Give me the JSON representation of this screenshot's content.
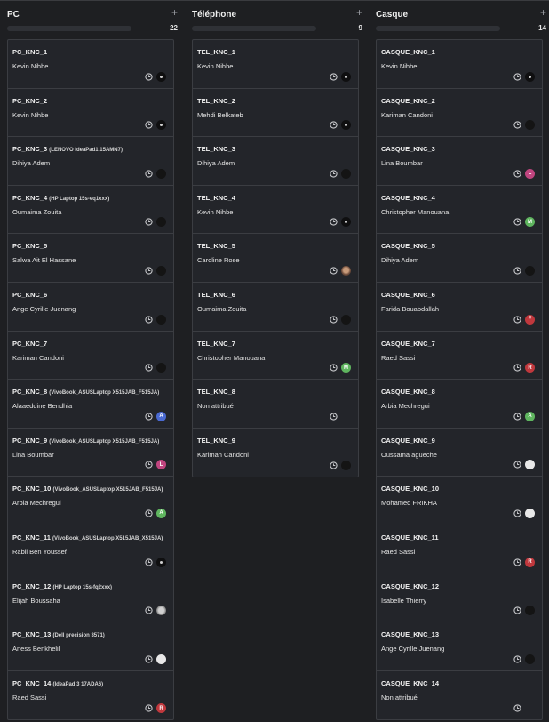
{
  "columns": [
    {
      "title": "PC",
      "count": "22",
      "cards": [
        {
          "title": "PC_KNC_1",
          "sub": "",
          "owner": "Kevin Nihbe",
          "avatar": {
            "kind": "dark",
            "letter": ""
          }
        },
        {
          "title": "PC_KNC_2",
          "sub": "",
          "owner": "Kevin Nihbe",
          "avatar": {
            "kind": "dark",
            "letter": ""
          }
        },
        {
          "title": "PC_KNC_3",
          "sub": "(LENOVO IdeaPad1 15AMN7)",
          "owner": "Dihiya Adem",
          "avatar": {
            "kind": "photo",
            "letter": ""
          }
        },
        {
          "title": "PC_KNC_4",
          "sub": "(HP Laptop 15s-eq1xxx)",
          "owner": "Oumaima Zouita",
          "avatar": {
            "kind": "photo",
            "letter": ""
          }
        },
        {
          "title": "PC_KNC_5",
          "sub": "",
          "owner": "Salwa Ait El Hassane",
          "avatar": {
            "kind": "photo",
            "letter": ""
          }
        },
        {
          "title": "PC_KNC_6",
          "sub": "",
          "owner": "Ange Cyrille Juenang",
          "avatar": {
            "kind": "photo",
            "letter": ""
          }
        },
        {
          "title": "PC_KNC_7",
          "sub": "",
          "owner": "Kariman Candoni",
          "avatar": {
            "kind": "photo",
            "letter": ""
          }
        },
        {
          "title": "PC_KNC_8",
          "sub": "(VivoBook_ASUSLaptop X515JAB_F515JA)",
          "owner": "Alaaeddine Bendhia",
          "avatar": {
            "kind": "blue",
            "letter": "A"
          }
        },
        {
          "title": "PC_KNC_9",
          "sub": "(VivoBook_ASUSLaptop X515JAB_F515JA)",
          "owner": "Lina Boumbar",
          "avatar": {
            "kind": "pink",
            "letter": "L"
          }
        },
        {
          "title": "PC_KNC_10",
          "sub": "(VivoBook_ASUSLaptop X515JAB_F515JA)",
          "owner": "Arbia Mechregui",
          "avatar": {
            "kind": "green",
            "letter": "A"
          }
        },
        {
          "title": "PC_KNC_11",
          "sub": "(VivoBook_ASUSLaptop X515JAB_X515JA)",
          "owner": "Rabii Ben Youssef",
          "avatar": {
            "kind": "dark",
            "letter": ""
          }
        },
        {
          "title": "PC_KNC_12",
          "sub": "(HP Laptop 15s-fq2xxx)",
          "owner": "Elijah Boussaha",
          "avatar": {
            "kind": "grey",
            "letter": ""
          }
        },
        {
          "title": "PC_KNC_13",
          "sub": "(Dell precision 3571)",
          "owner": "Aness Benkhelil",
          "avatar": {
            "kind": "light",
            "letter": ""
          }
        },
        {
          "title": "PC_KNC_14",
          "sub": "(IdeaPad 3 17ADA6)",
          "owner": "Raed Sassi",
          "avatar": {
            "kind": "red",
            "letter": "R"
          }
        }
      ]
    },
    {
      "title": "Téléphone",
      "count": "9",
      "cards": [
        {
          "title": "TEL_KNC_1",
          "sub": "",
          "owner": "Kevin Nihbe",
          "avatar": {
            "kind": "dark",
            "letter": ""
          }
        },
        {
          "title": "TEL_KNC_2",
          "sub": "",
          "owner": "Mehdi Belkateb",
          "avatar": {
            "kind": "dark",
            "letter": ""
          }
        },
        {
          "title": "TEL_KNC_3",
          "sub": "",
          "owner": "Dihiya Adem",
          "avatar": {
            "kind": "photo",
            "letter": ""
          }
        },
        {
          "title": "TEL_KNC_4",
          "sub": "",
          "owner": "Kevin Nihbe",
          "avatar": {
            "kind": "dark",
            "letter": ""
          }
        },
        {
          "title": "TEL_KNC_5",
          "sub": "",
          "owner": "Caroline Rose",
          "avatar": {
            "kind": "brown",
            "letter": ""
          }
        },
        {
          "title": "TEL_KNC_6",
          "sub": "",
          "owner": "Oumaima Zouita",
          "avatar": {
            "kind": "photo",
            "letter": ""
          }
        },
        {
          "title": "TEL_KNC_7",
          "sub": "",
          "owner": "Christopher Manouana",
          "avatar": {
            "kind": "green",
            "letter": "M"
          }
        },
        {
          "title": "TEL_KNC_8",
          "sub": "",
          "owner": "Non attribué",
          "avatar": {
            "kind": "none",
            "letter": ""
          }
        },
        {
          "title": "TEL_KNC_9",
          "sub": "",
          "owner": "Kariman Candoni",
          "avatar": {
            "kind": "photo",
            "letter": ""
          }
        }
      ]
    },
    {
      "title": "Casque",
      "count": "14",
      "cards": [
        {
          "title": "CASQUE_KNC_1",
          "sub": "",
          "owner": "Kevin Nihbe",
          "avatar": {
            "kind": "dark",
            "letter": ""
          }
        },
        {
          "title": "CASQUE_KNC_2",
          "sub": "",
          "owner": "Kariman Candoni",
          "avatar": {
            "kind": "photo",
            "letter": ""
          }
        },
        {
          "title": "CASQUE_KNC_3",
          "sub": "",
          "owner": "Lina Boumbar",
          "avatar": {
            "kind": "pink",
            "letter": "L"
          }
        },
        {
          "title": "CASQUE_KNC_4",
          "sub": "",
          "owner": "Christopher Manouana",
          "avatar": {
            "kind": "green",
            "letter": "M"
          }
        },
        {
          "title": "CASQUE_KNC_5",
          "sub": "",
          "owner": "Dihiya Adem",
          "avatar": {
            "kind": "photo",
            "letter": ""
          }
        },
        {
          "title": "CASQUE_KNC_6",
          "sub": "",
          "owner": "Farida Bouabdallah",
          "avatar": {
            "kind": "red",
            "letter": "F"
          }
        },
        {
          "title": "CASQUE_KNC_7",
          "sub": "",
          "owner": "Raed Sassi",
          "avatar": {
            "kind": "red",
            "letter": "R"
          }
        },
        {
          "title": "CASQUE_KNC_8",
          "sub": "",
          "owner": "Arbia Mechregui",
          "avatar": {
            "kind": "green",
            "letter": "A"
          }
        },
        {
          "title": "CASQUE_KNC_9",
          "sub": "",
          "owner": "Oussama agueche",
          "avatar": {
            "kind": "light",
            "letter": ""
          }
        },
        {
          "title": "CASQUE_KNC_10",
          "sub": "",
          "owner": "Mohamed FRIKHA",
          "avatar": {
            "kind": "light",
            "letter": ""
          }
        },
        {
          "title": "CASQUE_KNC_11",
          "sub": "",
          "owner": "Raed Sassi",
          "avatar": {
            "kind": "red",
            "letter": "R"
          }
        },
        {
          "title": "CASQUE_KNC_12",
          "sub": "",
          "owner": "Isabelle Thierry",
          "avatar": {
            "kind": "photo",
            "letter": ""
          }
        },
        {
          "title": "CASQUE_KNC_13",
          "sub": "",
          "owner": "Ange Cyrille Juenang",
          "avatar": {
            "kind": "photo",
            "letter": ""
          }
        },
        {
          "title": "CASQUE_KNC_14",
          "sub": "",
          "owner": "Non attribué",
          "avatar": {
            "kind": "none",
            "letter": ""
          }
        }
      ]
    }
  ],
  "icons": {
    "add": "plus-icon",
    "status": "clock-icon"
  },
  "colors": {
    "background": "#1e1f22",
    "card": "#23252a",
    "border": "#3b3d42"
  }
}
